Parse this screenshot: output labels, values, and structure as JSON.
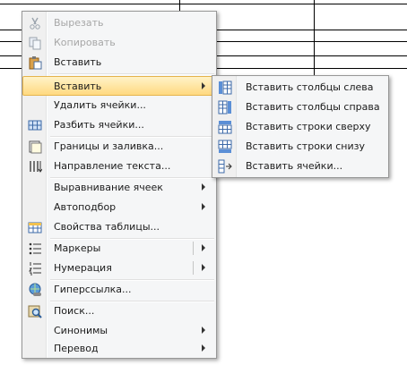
{
  "context_menu": {
    "items": [
      {
        "label": "Вырезать",
        "icon": "scissors-icon",
        "disabled": true
      },
      {
        "label": "Копировать",
        "icon": "copy-icon",
        "disabled": true
      },
      {
        "label": "Вставить",
        "icon": "paste-icon",
        "disabled": false
      },
      {
        "label": "Вставить",
        "icon": "",
        "submenu": true,
        "highlighted": true
      },
      {
        "label": "Удалить ячейки...",
        "icon": ""
      },
      {
        "label": "Разбить ячейки...",
        "icon": "split-cells-icon"
      },
      {
        "label": "Границы и заливка...",
        "icon": "borders-icon"
      },
      {
        "label": "Направление текста...",
        "icon": "text-direction-icon"
      },
      {
        "label": "Выравнивание ячеек",
        "icon": "",
        "submenu": true
      },
      {
        "label": "Автоподбор",
        "icon": "",
        "submenu": true
      },
      {
        "label": "Свойства таблицы...",
        "icon": "table-properties-icon"
      },
      {
        "label": "Маркеры",
        "icon": "bullets-icon",
        "submenu": true,
        "split": true
      },
      {
        "label": "Нумерация",
        "icon": "numbering-icon",
        "submenu": true,
        "split": true
      },
      {
        "label": "Гиперссылка...",
        "icon": "hyperlink-icon"
      },
      {
        "label": "Поиск...",
        "icon": "research-icon"
      },
      {
        "label": "Синонимы",
        "icon": "",
        "submenu": true
      },
      {
        "label": "Перевод",
        "icon": "",
        "submenu": true
      }
    ]
  },
  "insert_submenu": {
    "items": [
      {
        "label": "Вставить столбцы слева",
        "icon": "insert-columns-left-icon"
      },
      {
        "label": "Вставить столбцы справа",
        "icon": "insert-columns-right-icon"
      },
      {
        "label": "Вставить строки сверху",
        "icon": "insert-rows-above-icon"
      },
      {
        "label": "Вставить строки снизу",
        "icon": "insert-rows-below-icon"
      },
      {
        "label": "Вставить ячейки...",
        "icon": "insert-cells-icon"
      }
    ]
  },
  "colors": {
    "highlight_top": "#fff3c8",
    "highlight_bottom": "#ffd980",
    "highlight_border": "#e5b44c",
    "menu_bg": "#f5f6f7",
    "disabled_text": "#a7a7a7"
  }
}
